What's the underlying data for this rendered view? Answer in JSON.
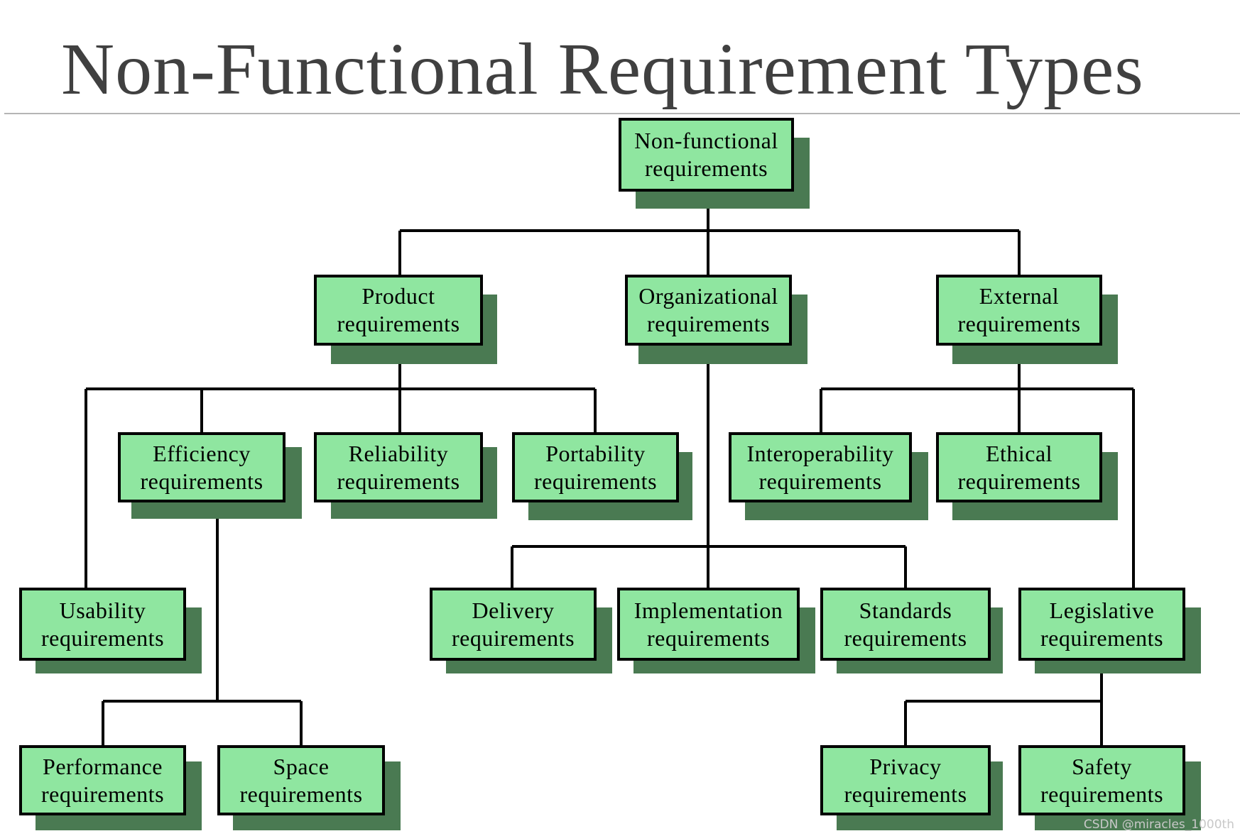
{
  "title": "Non-Functional Requirement Types",
  "watermark": "CSDN @miracles_1000th",
  "colors": {
    "box_fill": "#8fe6a0",
    "shadow": "#4a7a52",
    "border": "#000000",
    "title": "#404040"
  },
  "nodes": {
    "root": {
      "line1": "Non-functional",
      "line2": "requirements"
    },
    "product": {
      "line1": "Product",
      "line2": "requirements"
    },
    "organizational": {
      "line1": "Organizational",
      "line2": "requirements"
    },
    "external": {
      "line1": "External",
      "line2": "requirements"
    },
    "efficiency": {
      "line1": "Efficiency",
      "line2": "requirements"
    },
    "reliability": {
      "line1": "Reliability",
      "line2": "requirements"
    },
    "portability": {
      "line1": "Portability",
      "line2": "requirements"
    },
    "interoperability": {
      "line1": "Interoperability",
      "line2": "requirements"
    },
    "ethical": {
      "line1": "Ethical",
      "line2": "requirements"
    },
    "usability": {
      "line1": "Usability",
      "line2": "requirements"
    },
    "delivery": {
      "line1": "Delivery",
      "line2": "requirements"
    },
    "implementation": {
      "line1": "Implementation",
      "line2": "requirements"
    },
    "standards": {
      "line1": "Standards",
      "line2": "requirements"
    },
    "legislative": {
      "line1": "Legislative",
      "line2": "requirements"
    },
    "performance": {
      "line1": "Performance",
      "line2": "requirements"
    },
    "space": {
      "line1": "Space",
      "line2": "requirements"
    },
    "privacy": {
      "line1": "Privacy",
      "line2": "requirements"
    },
    "safety": {
      "line1": "Safety",
      "line2": "requirements"
    }
  },
  "edges": [
    [
      "root",
      "product"
    ],
    [
      "root",
      "organizational"
    ],
    [
      "root",
      "external"
    ],
    [
      "product",
      "usability"
    ],
    [
      "product",
      "efficiency"
    ],
    [
      "product",
      "reliability"
    ],
    [
      "product",
      "portability"
    ],
    [
      "efficiency",
      "performance"
    ],
    [
      "efficiency",
      "space"
    ],
    [
      "organizational",
      "delivery"
    ],
    [
      "organizational",
      "implementation"
    ],
    [
      "organizational",
      "standards"
    ],
    [
      "external",
      "interoperability"
    ],
    [
      "external",
      "ethical"
    ],
    [
      "external",
      "legislative"
    ],
    [
      "legislative",
      "privacy"
    ],
    [
      "legislative",
      "safety"
    ]
  ]
}
